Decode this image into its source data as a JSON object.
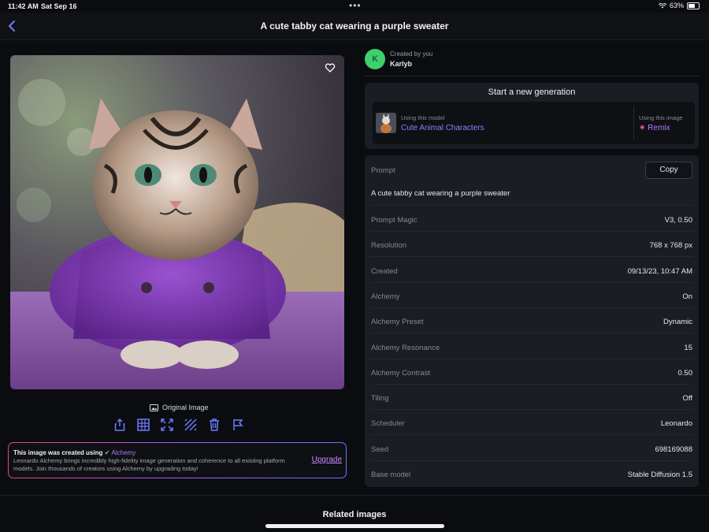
{
  "status_bar": {
    "time": "11:42 AM",
    "date": "Sat Sep 16",
    "battery": "63%",
    "battery_level": 0.63
  },
  "nav": {
    "title": "A cute tabby cat wearing a purple sweater"
  },
  "image": {
    "original_label": "Original Image"
  },
  "toolbar_icons": [
    "share-icon",
    "upscale-grid-icon",
    "expand-icon",
    "remove-background-icon",
    "trash-icon",
    "flag-icon"
  ],
  "promo": {
    "heading_prefix": "This image was created using",
    "heading_highlight": "Alchemy",
    "body": "Leonardo Alchemy brings incredibly high-fidelity image generation and coherence to all existing platform models. Join thousands of creators using Alchemy by upgrading today!",
    "upgrade_label": "Upgrade"
  },
  "creator": {
    "initial": "K",
    "created_by": "Created by you",
    "username": "Karlyb"
  },
  "generation": {
    "title": "Start a new generation",
    "model_label": "Using this model",
    "model_name": "Cute Animal Characters",
    "image_label": "Using this image",
    "remix_label": "Remix"
  },
  "details": {
    "prompt_label": "Prompt",
    "copy_label": "Copy",
    "prompt_text": "A cute tabby cat wearing a purple sweater",
    "rows": [
      {
        "label": "Prompt Magic",
        "value": "V3, 0.50"
      },
      {
        "label": "Resolution",
        "value": "768 x 768 px"
      },
      {
        "label": "Created",
        "value": "09/13/23, 10:47 AM"
      },
      {
        "label": "Alchemy",
        "value": "On"
      },
      {
        "label": "Alchemy Preset",
        "value": "Dynamic"
      },
      {
        "label": "Alchemy Resonance",
        "value": "15"
      },
      {
        "label": "Alchemy Contrast",
        "value": "0.50"
      },
      {
        "label": "Tiling",
        "value": "Off"
      },
      {
        "label": "Scheduler",
        "value": "Leonardo"
      },
      {
        "label": "Seed",
        "value": "698169088"
      },
      {
        "label": "Base model",
        "value": "Stable Diffusion 1.5"
      }
    ]
  },
  "related": {
    "title": "Related images"
  },
  "colors": {
    "accent": "#6d7cff",
    "alchemy": "#b07dff",
    "avatar": "#3ed06b",
    "panel": "#1b1d25",
    "background": "#0b0c10"
  }
}
